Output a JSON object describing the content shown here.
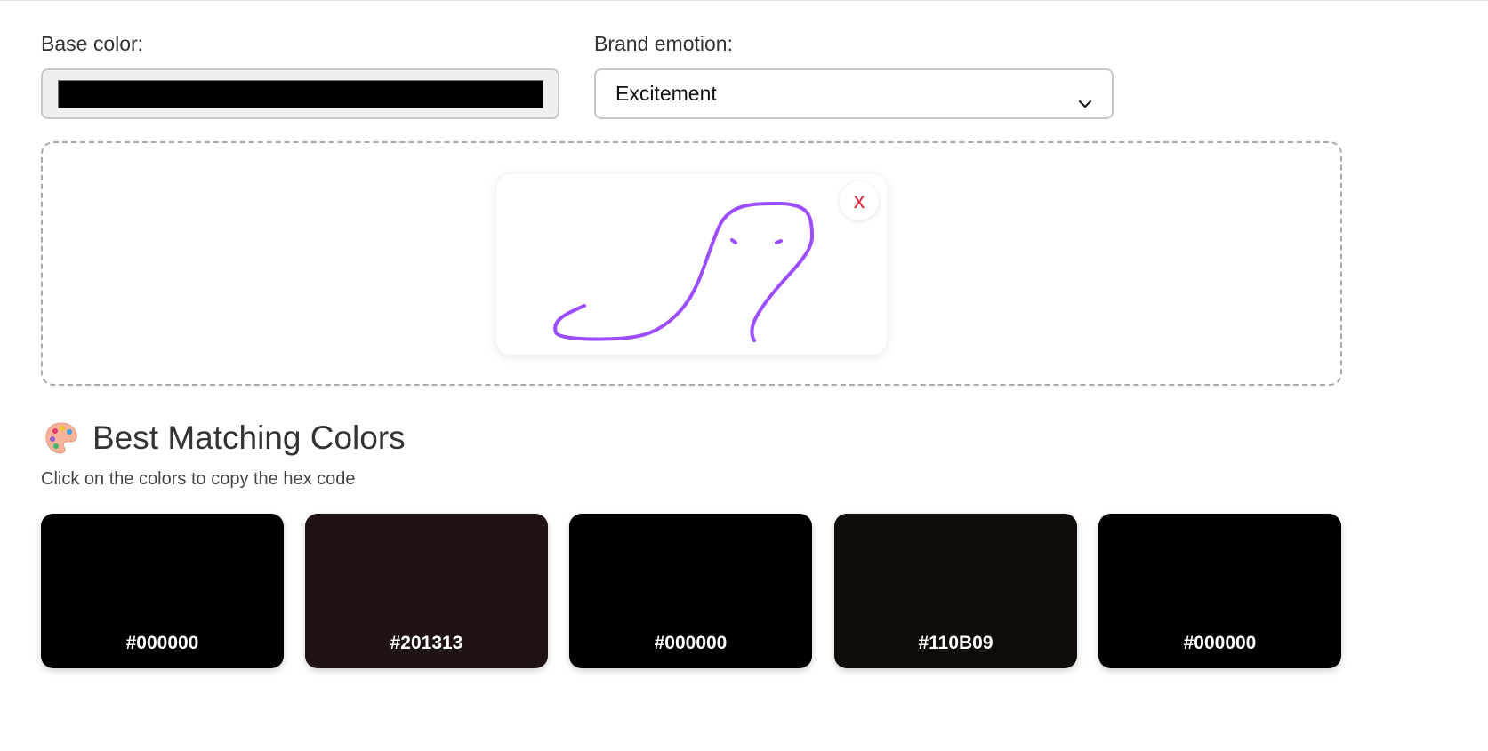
{
  "form": {
    "base_color_label": "Base color:",
    "base_color_value": "#000000",
    "emotion_label": "Brand emotion:",
    "emotion_selected": "Excitement"
  },
  "upload": {
    "remove_label": "x",
    "sketch_color": "#9b4dff"
  },
  "results": {
    "heading": "Best Matching Colors",
    "hint": "Click on the colors to copy the hex code",
    "swatches": [
      {
        "hex": "#000000",
        "color": "#000000"
      },
      {
        "hex": "#201313",
        "color": "#201313"
      },
      {
        "hex": "#000000",
        "color": "#000000"
      },
      {
        "hex": "#110B09",
        "color": "#110B09"
      },
      {
        "hex": "#000000",
        "color": "#000000"
      }
    ]
  },
  "icons": {
    "dropdown": "chevron-down-icon",
    "palette": "palette-icon",
    "remove": "close-icon"
  }
}
